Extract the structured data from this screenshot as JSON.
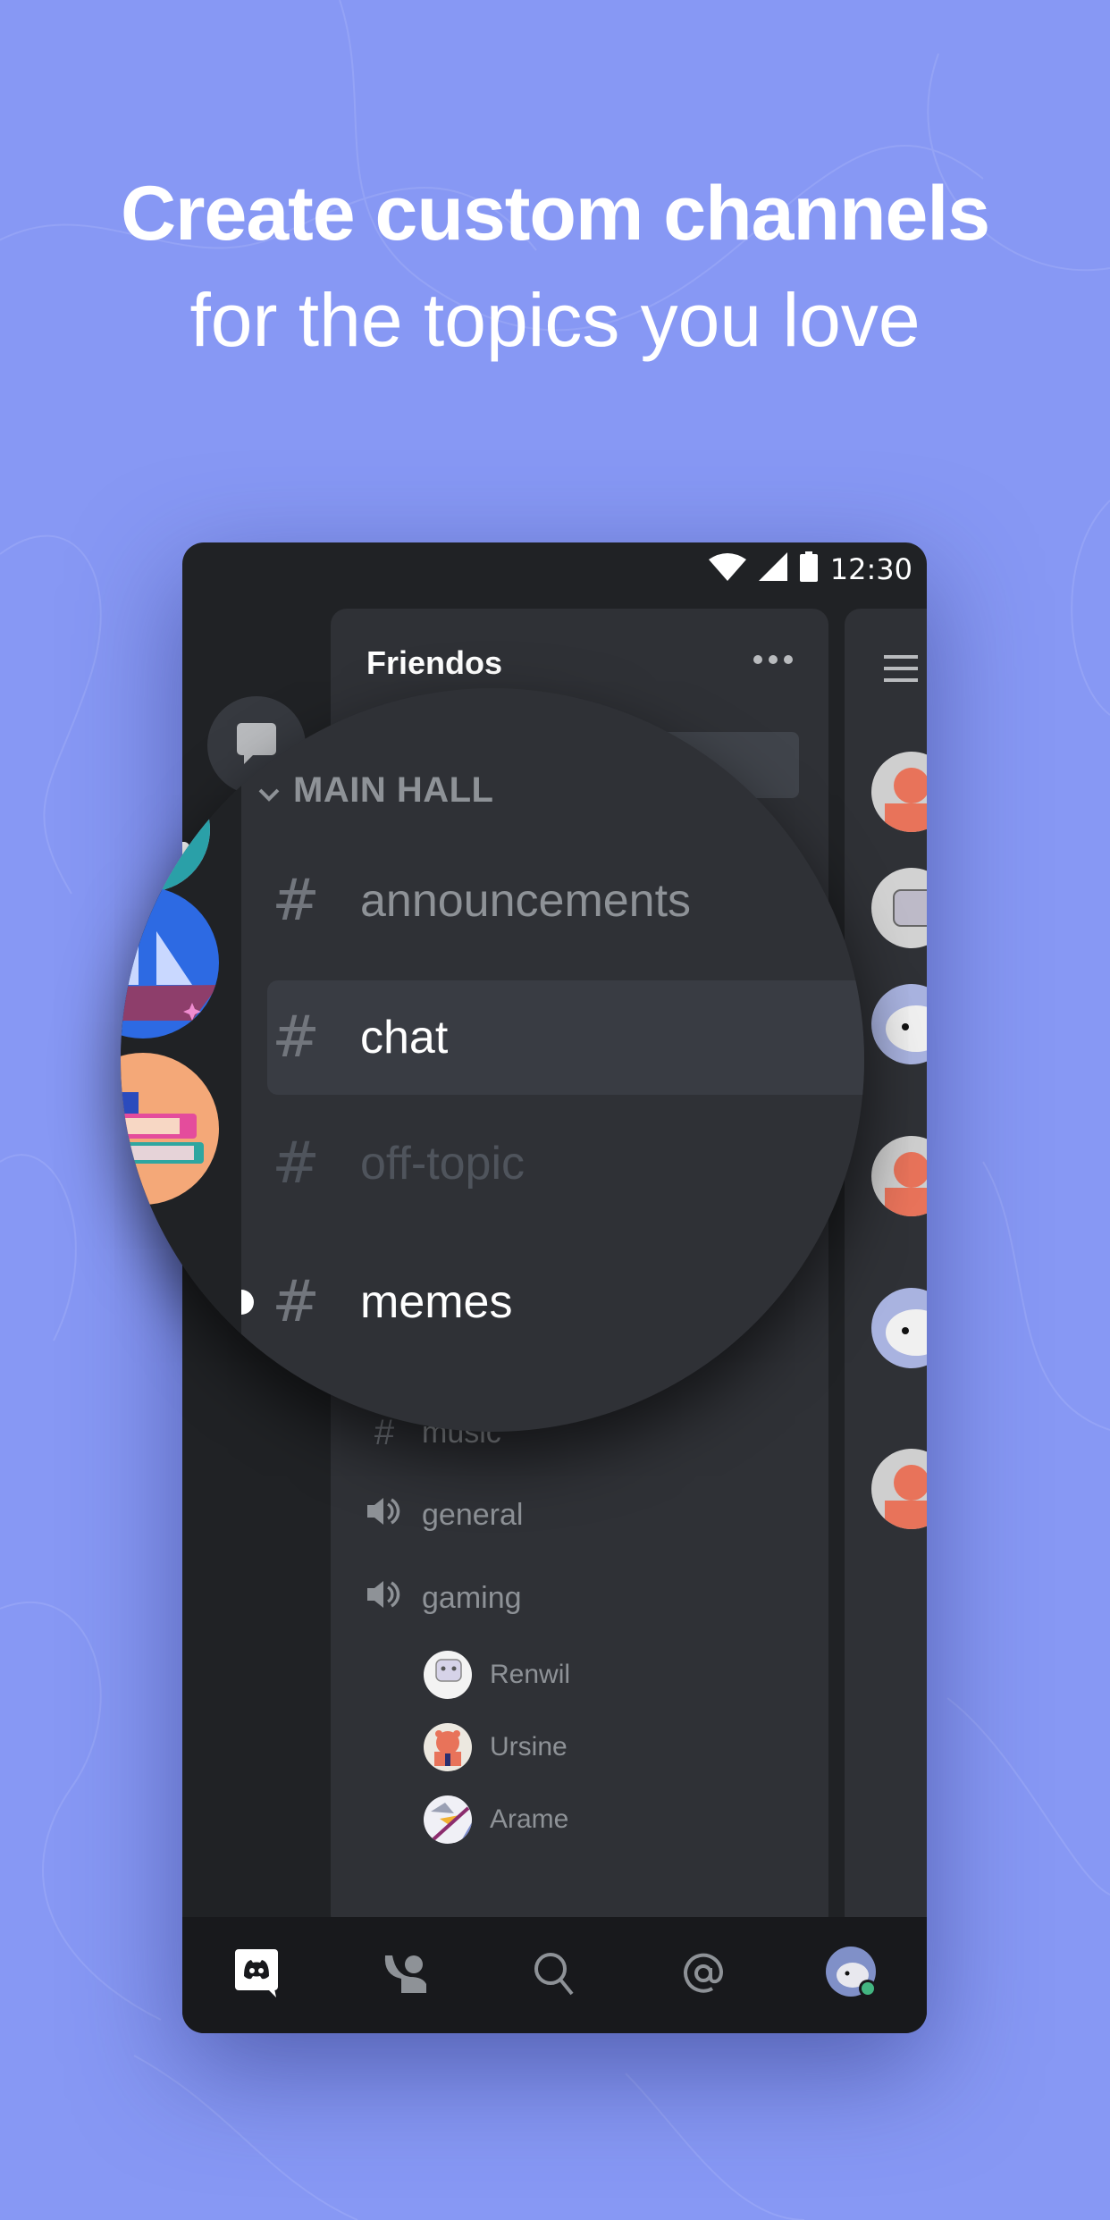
{
  "headline": {
    "line1": "Create custom channels",
    "line2": "for the topics you love"
  },
  "colors": {
    "background": "#8798f4",
    "phone_bg": "#202225",
    "panel_bg": "#2f3136",
    "nav_bg": "#18191c",
    "selected_row": "#393c43",
    "online": "#43b581"
  },
  "status_bar": {
    "time": "12:30",
    "icons": [
      "wifi-icon",
      "signal-icon",
      "battery-icon"
    ]
  },
  "server_rail": {
    "dm_icon": "chat-bubble-icon",
    "servers": [
      {
        "name": "server-sailboat",
        "icon": "sailboat-icon"
      },
      {
        "name": "server-books",
        "icon": "books-icon"
      }
    ]
  },
  "channel_panel": {
    "server_name": "Friendos",
    "more_icon": "more-icon",
    "category": "MAIN HALL",
    "channels": [
      {
        "name": "announcements",
        "type": "text",
        "state": "normal"
      },
      {
        "name": "chat",
        "type": "text",
        "state": "selected"
      },
      {
        "name": "off-topic",
        "type": "text",
        "state": "muted"
      },
      {
        "name": "memes",
        "type": "text",
        "state": "unread"
      },
      {
        "name": "music",
        "type": "text",
        "state": "normal"
      }
    ],
    "voice_channels": [
      {
        "name": "general",
        "type": "voice"
      },
      {
        "name": "gaming",
        "type": "voice",
        "users": [
          "Renwil",
          "Ursine",
          "Arame"
        ]
      }
    ]
  },
  "member_rail": {
    "menu_icon": "hamburger-icon",
    "members": [
      "bear",
      "ghost",
      "cat",
      "bear",
      "cat",
      "bear"
    ]
  },
  "bottom_nav": {
    "items": [
      {
        "name": "home",
        "icon": "discord-icon",
        "active": true
      },
      {
        "name": "friends",
        "icon": "friends-icon",
        "active": false
      },
      {
        "name": "search",
        "icon": "search-icon",
        "active": false
      },
      {
        "name": "mentions",
        "icon": "at-icon",
        "active": false
      },
      {
        "name": "profile",
        "icon": "avatar-icon",
        "active": false,
        "status": "online"
      }
    ]
  }
}
